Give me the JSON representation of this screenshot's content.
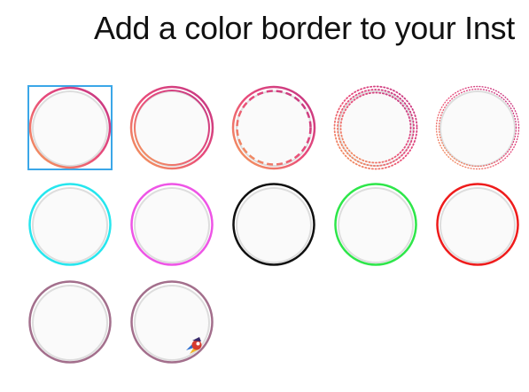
{
  "header": {
    "title": "Add a color border to your Inst"
  },
  "border_options": [
    {
      "id": "gradient-ring",
      "style": "gradient-single",
      "colors": [
        "#f4a259",
        "#e94c7b",
        "#c13584"
      ],
      "selected": true
    },
    {
      "id": "gradient-double-ring",
      "style": "gradient-double",
      "colors": [
        "#f4a259",
        "#e94c7b",
        "#c13584"
      ],
      "selected": false
    },
    {
      "id": "gradient-dashed-ring",
      "style": "gradient-dashed",
      "colors": [
        "#f4a259",
        "#e94c7b",
        "#c13584"
      ],
      "selected": false
    },
    {
      "id": "gradient-dotted-ring",
      "style": "gradient-dotted",
      "colors": [
        "#f4a259",
        "#e94c7b",
        "#c13584"
      ],
      "selected": false
    },
    {
      "id": "gradient-fine-dotted-ring",
      "style": "gradient-fine-dotted",
      "colors": [
        "#f4a259",
        "#e94c7b",
        "#c13584"
      ],
      "selected": false
    },
    {
      "id": "cyan-ring",
      "style": "solid",
      "colors": [
        "#26e6ee"
      ],
      "selected": false
    },
    {
      "id": "magenta-ring",
      "style": "solid",
      "colors": [
        "#ee55e6"
      ],
      "selected": false
    },
    {
      "id": "black-ring",
      "style": "solid",
      "colors": [
        "#111111"
      ],
      "selected": false
    },
    {
      "id": "green-ring",
      "style": "solid",
      "colors": [
        "#2ee64a"
      ],
      "selected": false
    },
    {
      "id": "red-ring",
      "style": "solid",
      "colors": [
        "#ee1c1c"
      ],
      "selected": false
    },
    {
      "id": "mauve-ring",
      "style": "solid",
      "colors": [
        "#a36f8c"
      ],
      "selected": false
    },
    {
      "id": "mauve-ring-with-badge",
      "style": "solid-badge",
      "colors": [
        "#a36f8c"
      ],
      "selected": false,
      "badge_icon": "rocket-badge-icon"
    }
  ],
  "colors": {
    "selection_outline": "#3ba7e8",
    "inner_circle_fill": "#fafafa",
    "inner_circle_shadow": "#dddddd"
  }
}
